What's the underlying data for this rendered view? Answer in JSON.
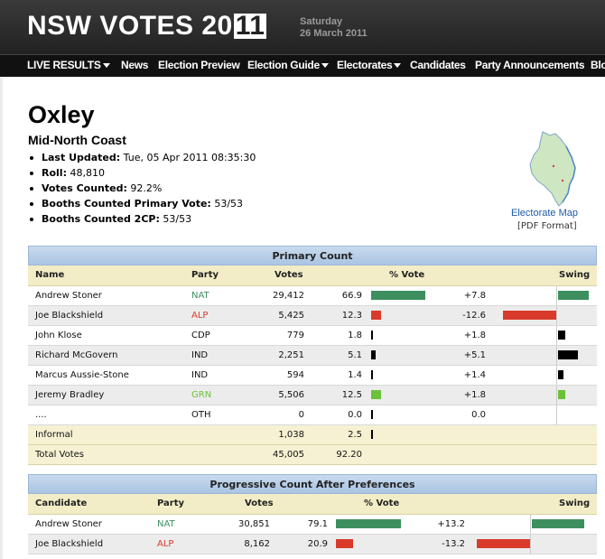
{
  "header": {
    "title_part1": "NSW VOTES 20",
    "title_box": "11",
    "date_line1": "Saturday",
    "date_line2": "26 March 2011"
  },
  "nav": {
    "items": [
      {
        "label": "LIVE RESULTS",
        "dropdown": true
      },
      {
        "label": "News",
        "dropdown": false
      },
      {
        "label": "Election Preview",
        "dropdown": false
      },
      {
        "label": "Election Guide",
        "dropdown": true
      },
      {
        "label": "Electorates",
        "dropdown": true
      },
      {
        "label": "Candidates",
        "dropdown": false
      },
      {
        "label": "Party Announcements",
        "dropdown": false
      },
      {
        "label": "Blo",
        "dropdown": false
      }
    ]
  },
  "electorate": {
    "name": "Oxley",
    "region": "Mid-North Coast",
    "info": [
      {
        "label": "Last Updated:",
        "value": "Tue, 05 Apr 2011 08:35:30"
      },
      {
        "label": "Roll:",
        "value": "48,810"
      },
      {
        "label": "Votes Counted:",
        "value": "92.2%"
      },
      {
        "label": "Booths Counted Primary Vote:",
        "value": "53/53"
      },
      {
        "label": "Booths Counted 2CP:",
        "value": "53/53"
      }
    ],
    "map_link": "Electorate Map",
    "map_format": "[PDF Format]"
  },
  "colors": {
    "NAT": "#3d8f5f",
    "ALP": "#d93a2b",
    "GRN": "#6cc13a",
    "OTHER": "#000000",
    "party_text_NAT": "#3d8f5f",
    "party_text_ALP": "#d93a2b",
    "party_text_GRN": "#6cc13a"
  },
  "primary": {
    "caption": "Primary Count",
    "headers": {
      "name": "Name",
      "party": "Party",
      "votes": "Votes",
      "pct": "% Vote",
      "swing": "Swing"
    },
    "rows": [
      {
        "name": "Andrew Stoner",
        "party": "NAT",
        "votes": "29,412",
        "pct": "66.9",
        "pct_num": 66.9,
        "swing": "+7.8",
        "swing_num": 7.8
      },
      {
        "name": "Joe Blackshield",
        "party": "ALP",
        "votes": "5,425",
        "pct": "12.3",
        "pct_num": 12.3,
        "swing": "-12.6",
        "swing_num": -12.6
      },
      {
        "name": "John Klose",
        "party": "CDP",
        "votes": "779",
        "pct": "1.8",
        "pct_num": 1.8,
        "swing": "+1.8",
        "swing_num": 1.8
      },
      {
        "name": "Richard McGovern",
        "party": "IND",
        "votes": "2,251",
        "pct": "5.1",
        "pct_num": 5.1,
        "swing": "+5.1",
        "swing_num": 5.1
      },
      {
        "name": "Marcus Aussie-Stone",
        "party": "IND",
        "votes": "594",
        "pct": "1.4",
        "pct_num": 1.4,
        "swing": "+1.4",
        "swing_num": 1.4
      },
      {
        "name": "Jeremy Bradley",
        "party": "GRN",
        "votes": "5,506",
        "pct": "12.5",
        "pct_num": 12.5,
        "swing": "+1.8",
        "swing_num": 1.8
      },
      {
        "name": "....",
        "party": "OTH",
        "votes": "0",
        "pct": "0.0",
        "pct_num": 0,
        "swing": "0.0",
        "swing_num": 0
      }
    ],
    "informal": {
      "label": "Informal",
      "votes": "1,038",
      "pct": "2.5",
      "pct_num": 2.5
    },
    "total": {
      "label": "Total Votes",
      "votes": "45,005",
      "pct": "92.20"
    }
  },
  "tcp": {
    "caption": "Progressive Count After Preferences",
    "headers": {
      "name": "Candidate",
      "party": "Party",
      "votes": "Votes",
      "pct": "% Vote",
      "swing": "Swing"
    },
    "rows": [
      {
        "name": "Andrew Stoner",
        "party": "NAT",
        "votes": "30,851",
        "pct": "79.1",
        "pct_num": 79.1,
        "swing": "+13.2",
        "swing_num": 13.2
      },
      {
        "name": "Joe Blackshield",
        "party": "ALP",
        "votes": "8,162",
        "pct": "20.9",
        "pct_num": 20.9,
        "swing": "-13.2",
        "swing_num": -13.2
      }
    ]
  }
}
